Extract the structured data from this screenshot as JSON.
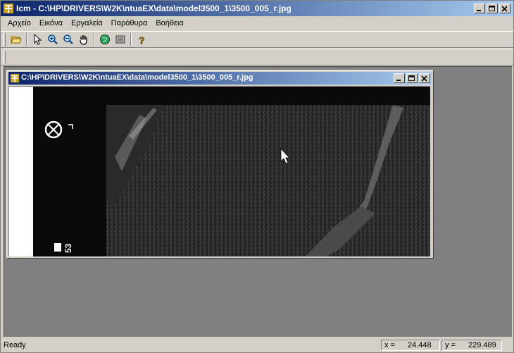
{
  "app": {
    "title": "Icm - C:\\HP\\DRIVERS\\W2K\\ntuaEX\\data\\model3500_1\\3500_005_r.jpg"
  },
  "menu": [
    "Αρχείο",
    "Εικόνα",
    "Εργαλεία",
    "Παράθυρα",
    "Βοήθεια"
  ],
  "toolbar": {
    "icons": [
      "open-folder-icon",
      "pointer-icon",
      "zoom-in-icon",
      "zoom-out-icon",
      "pan-hand-icon",
      "globe-icon",
      "image-settings-icon",
      "help-icon"
    ]
  },
  "child_window": {
    "title": "C:\\HP\\DRIVERS\\W2K\\ntuaEX\\data\\model3500_1\\3500_005_r.jpg",
    "image_label": "53"
  },
  "status": {
    "ready": "Ready",
    "x_label": "x =",
    "x_value": "24.448",
    "y_label": "y =",
    "y_value": "229.489"
  }
}
